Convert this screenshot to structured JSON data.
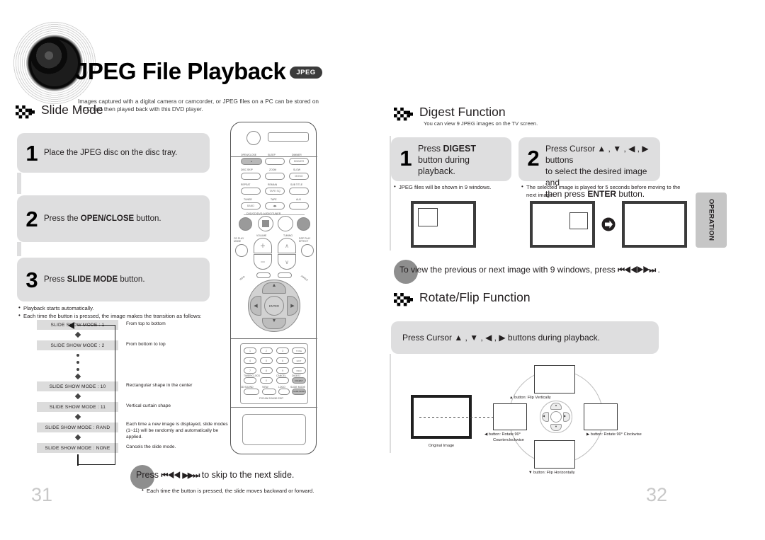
{
  "document": {
    "title": "JPEG File Playback",
    "format_badge": "JPEG",
    "description": "Images captured with a digital camera or camcorder, or JPEG files on a PC can be stored on a CD and then played back with this DVD player.",
    "side_tab": "OPERATION",
    "page_left": "31",
    "page_right": "32"
  },
  "slide_mode": {
    "heading": "Slide Mode",
    "steps": [
      {
        "num": "1",
        "text_before": "Place the JPEG disc on the disc tray.",
        "bold": "",
        "text_after": ""
      },
      {
        "num": "2",
        "text_before": "Press the ",
        "bold": "OPEN/CLOSE",
        "text_after": " button."
      },
      {
        "num": "3",
        "text_before": "Press ",
        "bold": "SLIDE MODE",
        "text_after": " button."
      }
    ],
    "notes": [
      "Playback starts automatically.",
      "Each time the button is pressed, the image makes the transition as follows:"
    ],
    "flow": [
      {
        "box": "SLIDE SHOW MODE : 1",
        "desc": "From top to bottom"
      },
      {
        "box": "SLIDE SHOW MODE : 2",
        "desc": "From bottom to top"
      },
      {
        "box": "SLIDE SHOW MODE : 10",
        "desc": "Rectangular shape in the center"
      },
      {
        "box": "SLIDE SHOW MODE : 11",
        "desc": "Vertical curtain shape"
      },
      {
        "box": "SLIDE SHOW MODE : RAND",
        "desc": "Each time a new image is displayed, slide modes (1~11) will be randomly and automatically be applied."
      },
      {
        "box": "SLIDE SHOW MODE : NONE",
        "desc": "Cancels the slide mode."
      }
    ],
    "skip_tip": {
      "before": "Press ",
      "icon_prev": "⏮◀◀",
      "icon_next": "▶▶⏭",
      "after": " to skip to the next slide."
    },
    "skip_note": "Each time the button is pressed, the slide moves backward or forward."
  },
  "digest": {
    "heading": "Digest Function",
    "subtitle": "You can view 9 JPEG images on the TV screen.",
    "steps": [
      {
        "num": "1",
        "line1_before": "Press ",
        "line1_bold": "DIGEST",
        "line2": "button during",
        "line3": "playback.",
        "note": "JPEG files will be shown in 9 windows."
      },
      {
        "num": "2",
        "line1": "Press Cursor ▲ , ▼ , ◀ , ▶ buttons",
        "line2": "to select the desired image and",
        "line3_before": "then press ",
        "line3_bold": "ENTER",
        "line3_after": " button.",
        "note": "The selected image is played for 5 seconds before moving to the next image."
      }
    ],
    "tip": {
      "before": "To view the previous or next image with 9 windows, press ",
      "icon_prev": "⏮◀◀",
      "icon_next": "▶▶⏭",
      "after": " ."
    }
  },
  "rotate_flip": {
    "heading": "Rotate/Flip Function",
    "instruction": "Press Cursor ▲ , ▼ , ◀ , ▶  buttons during playback.",
    "original_label": "Original Image",
    "labels": {
      "up": "▲ button: Flip Vertically",
      "down": "▼ button: Flip Horizontally",
      "left_line1": "◀ button: Rotate 90°",
      "left_line2": "Counterclockwise",
      "right": "▶ button: Rotate 90° Clockwise"
    }
  },
  "remote": {
    "name": "dvd-remote-control",
    "rows": [
      [
        "OPEN/CLOSE",
        "SLEEP",
        "DIMMER"
      ],
      [
        "DISC SKIP",
        "ZOOM",
        "SLOW"
      ],
      [
        "REPEAT",
        "REMAIN",
        "SUB TITLE"
      ],
      [
        "TUNER",
        "TAPE",
        "AUX"
      ]
    ],
    "source_label": "DVD/CD/DVD-AUDIO/TUNER",
    "volume_label": "VOLUME",
    "tuning_label": "TUNING",
    "enter_label": "ENTER",
    "digest_button": "DIGEST",
    "slide_mode_button": "SLIDE MODE"
  },
  "colors": {
    "panel_gray": "#dededf",
    "box_gray": "#dcdcdc",
    "badge_gray": "#8e8e8e",
    "tab_gray": "#c6c6c6",
    "page_number": "#c8c8c8",
    "tv_border": "#3b3b3b"
  }
}
